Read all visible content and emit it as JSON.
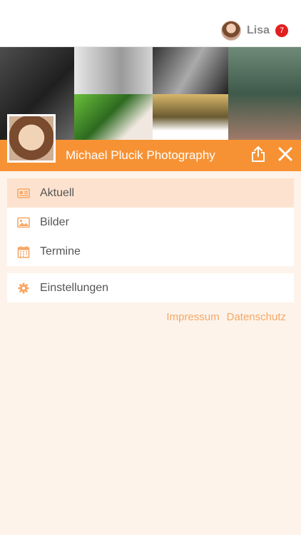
{
  "user": {
    "name": "Lisa",
    "notification_count": "7"
  },
  "header": {
    "title": "Michael Plucik Photography"
  },
  "menu": {
    "items": [
      {
        "label": "Aktuell",
        "icon": "newspaper-icon",
        "active": true
      },
      {
        "label": "Bilder",
        "icon": "image-icon",
        "active": false
      },
      {
        "label": "Termine",
        "icon": "calendar-icon",
        "active": false
      }
    ],
    "settings": {
      "label": "Einstellungen",
      "icon": "gear-icon"
    }
  },
  "footer": {
    "links": [
      "Impressum",
      "Datenschutz"
    ]
  },
  "colors": {
    "accent": "#f79234",
    "icon": "#f5a867",
    "background": "#fdf3ea",
    "active_row": "#fde3cf",
    "badge": "#e02020"
  }
}
